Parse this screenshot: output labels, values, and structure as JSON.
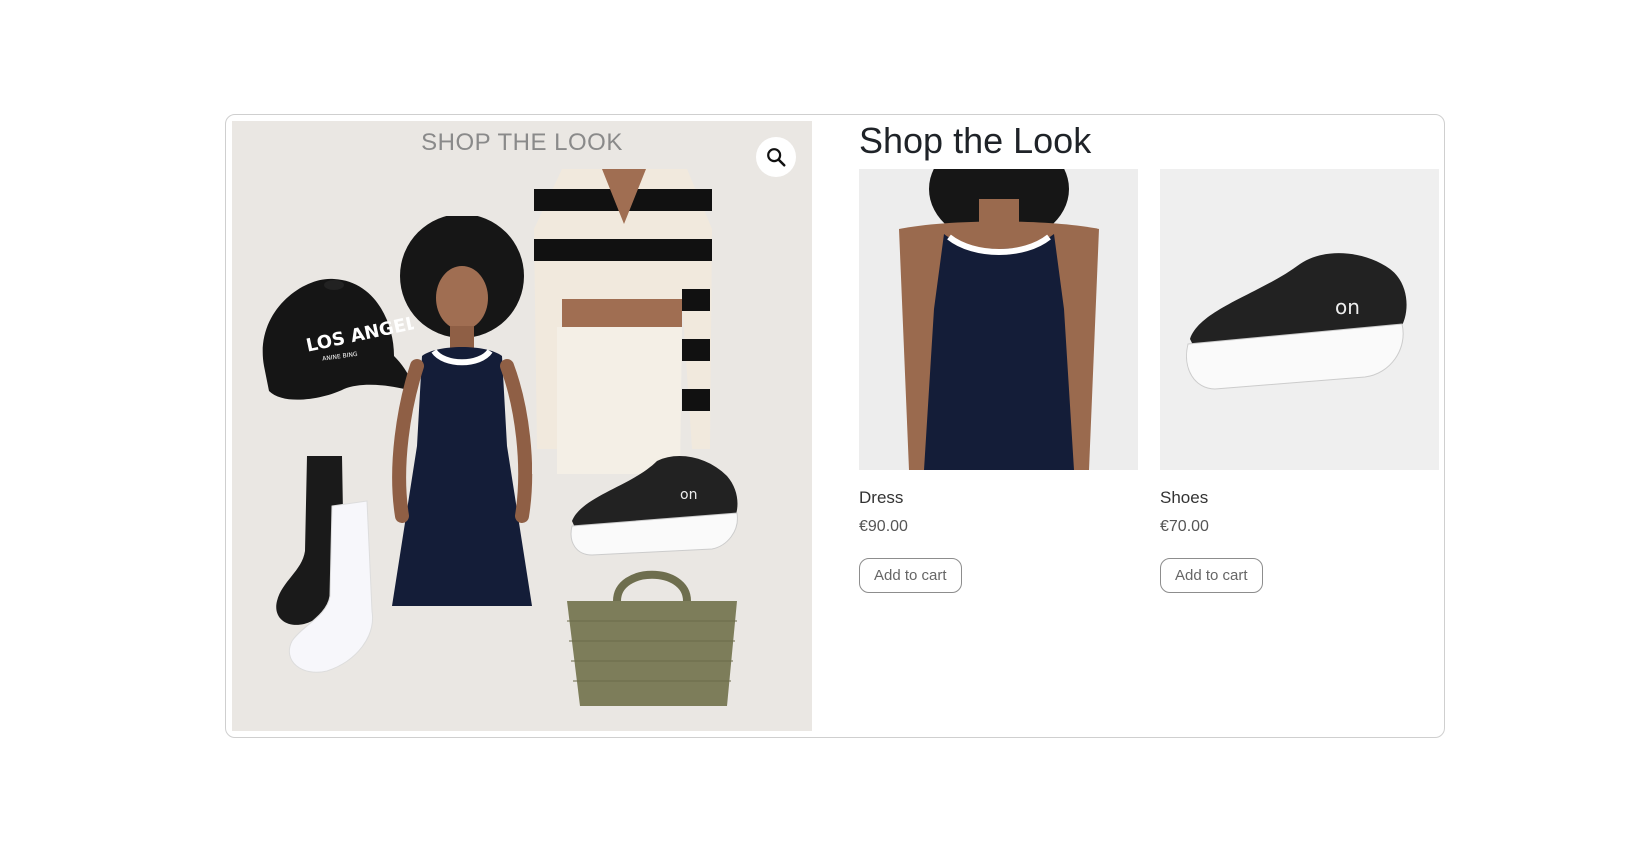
{
  "lookbook": {
    "title": "SHOP THE LOOK",
    "zoom_icon": "search-icon",
    "cap_text_1": "LOS ANGELES",
    "cap_text_2": "ANINE BING"
  },
  "section": {
    "title": "Shop the Look"
  },
  "products": [
    {
      "name": "Dress",
      "price": "€90.00",
      "button": "Add to cart"
    },
    {
      "name": "Shoes",
      "price": "€70.00",
      "button": "Add to cart"
    }
  ],
  "colors": {
    "navy_dress": "#141d38",
    "olive_bag": "#7d7d5a",
    "collage_bg": "#eae7e3"
  }
}
